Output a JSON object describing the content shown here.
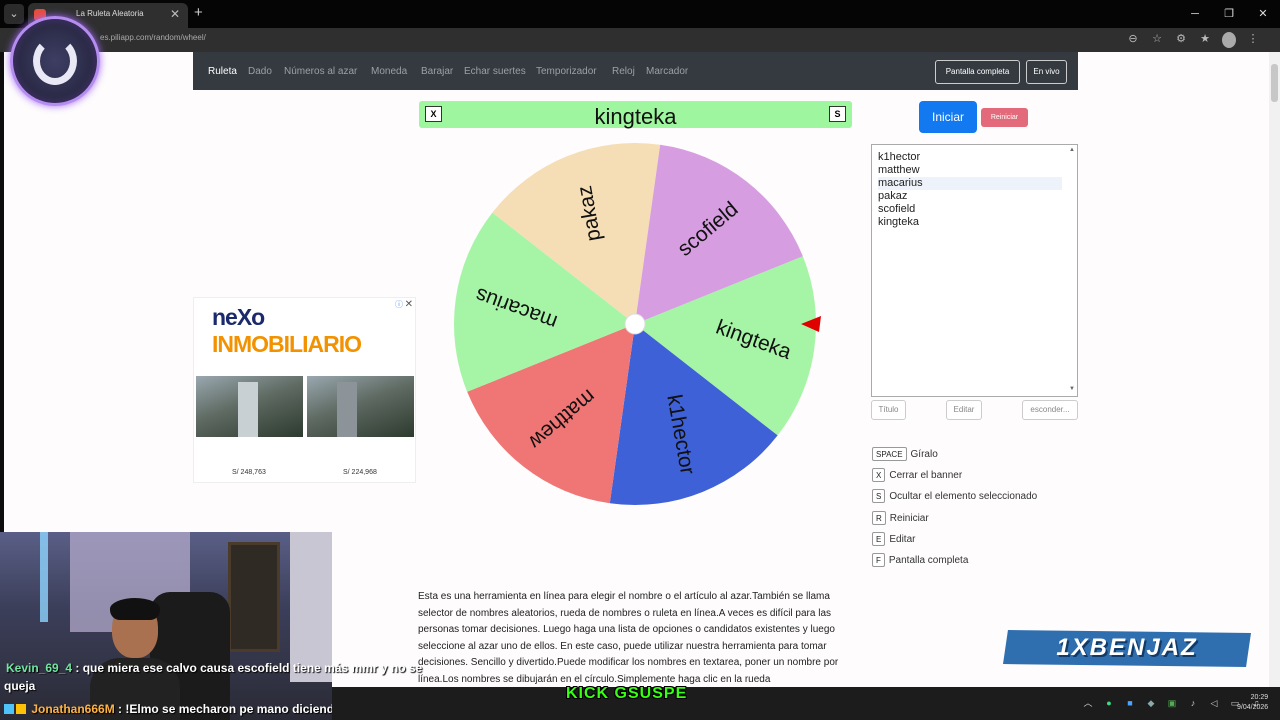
{
  "browser": {
    "tab_title": "La Ruleta Aleatoria",
    "tab_close": "✕",
    "new_tab": "+",
    "url": "es.piliapp.com/random/wheel/"
  },
  "navbar": {
    "items": [
      "Ruleta",
      "Dado",
      "Números al azar",
      "Moneda",
      "Barajar",
      "Echar suertes",
      "Temporizador",
      "Reloj",
      "Marcador"
    ],
    "fullscreen_button": "Pantalla completa",
    "live_button": "En vivo"
  },
  "header": {
    "close_key": "X",
    "title": "kingteka",
    "hide_key": "S"
  },
  "wheel": {
    "segments": [
      {
        "label": "kingteka",
        "color": "#a6f5a6"
      },
      {
        "label": "k1hector",
        "color": "#3e61d8"
      },
      {
        "label": "matthew",
        "color": "#f07575"
      },
      {
        "label": "macarius",
        "color": "#a6f5a6"
      },
      {
        "label": "pakaz",
        "color": "#f5deb6"
      },
      {
        "label": "scofield",
        "color": "#d69de0"
      }
    ],
    "pointer_color": "#e00000"
  },
  "controls": {
    "start_button": "Iniciar",
    "reset_button": "Reiniciar",
    "names": [
      "k1hector",
      "matthew",
      "macarius",
      "pakaz",
      "scofield",
      "kingteka"
    ],
    "title_button": "Título",
    "edit_button": "Editar",
    "hide_button": "esconder..."
  },
  "shortcuts": [
    {
      "key": "SPACE",
      "desc": "Gíralo"
    },
    {
      "key": "X",
      "desc": "Cerrar el banner"
    },
    {
      "key": "S",
      "desc": "Ocultar el elemento seleccionado"
    },
    {
      "key": "R",
      "desc": "Reiniciar"
    },
    {
      "key": "E",
      "desc": "Editar"
    },
    {
      "key": "F",
      "desc": "Pantalla completa"
    }
  ],
  "ad": {
    "brand_part1": "neXo",
    "brand_part2": "INMOBILIARIO",
    "price1": "S/ 248,763",
    "price2": "S/ 224,968"
  },
  "description": "Esta es una herramienta en línea para elegir el nombre o el artículo al azar.También se llama selector de nombres aleatorios, rueda de nombres o ruleta en línea.A veces es difícil para las personas tomar decisiones. Luego haga una lista de opciones o candidatos existentes y luego seleccione al azar uno de ellos. En este caso, puede utilizar nuestra herramienta para tomar decisiones. Sencillo y divertido.Puede modificar los nombres en textarea, poner un nombre por línea.Los nombres se dibujarán en el círculo.Simplemente haga clic en la rueda",
  "chat": [
    {
      "user": "Kevin_69_4",
      "message": ": que miera ese calvo causa escofield tiene más mmr y no se",
      "message_cont": "queja"
    },
    {
      "user": "Jonathan666M",
      "message": ": !Elmo se mecharon pe mano diciendo codigo awa xd"
    }
  ],
  "overlay": {
    "kick_text": "KICK GSUSPE",
    "brand_text": "1XBENJAZ"
  },
  "taskbar": {
    "time": "20:29",
    "date": "9/04/2026"
  }
}
